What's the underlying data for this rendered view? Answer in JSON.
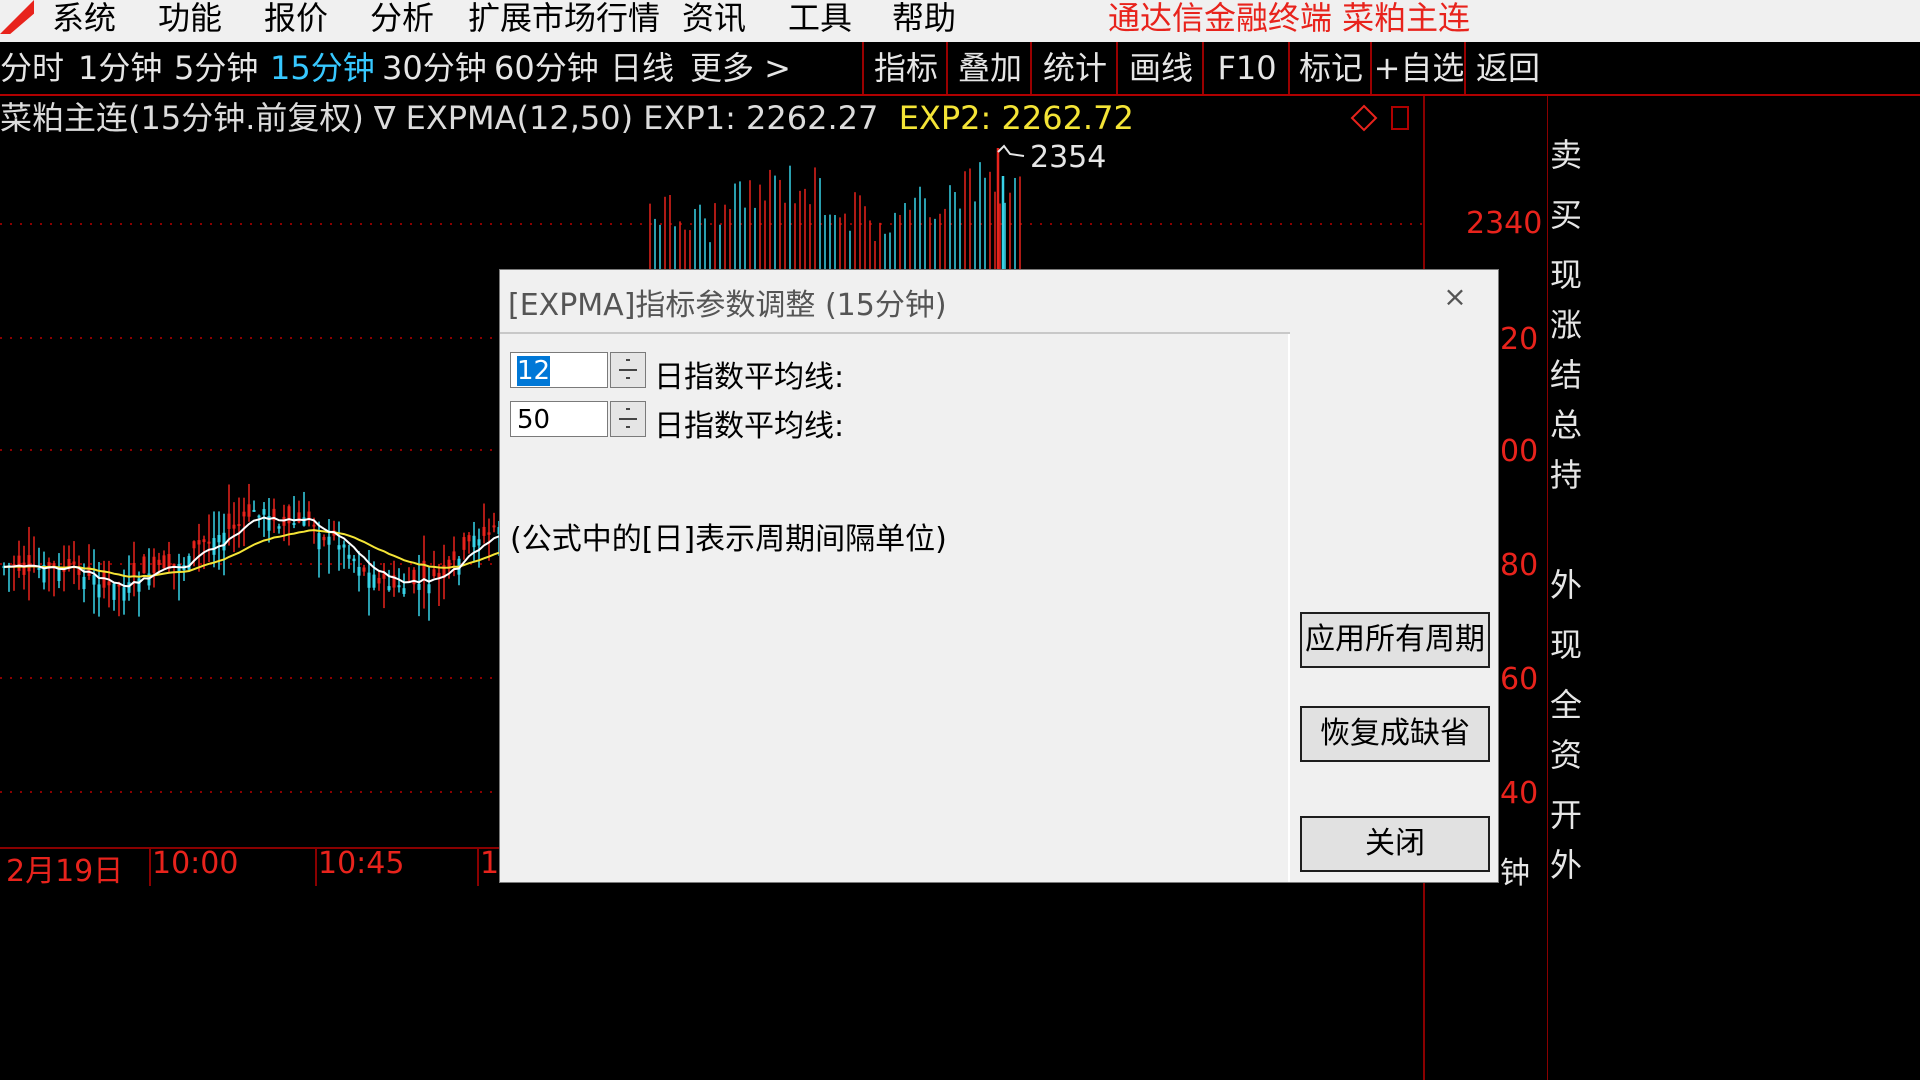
{
  "menu": {
    "items": [
      "系统",
      "功能",
      "报价",
      "分析",
      "扩展市场行情",
      "资讯",
      "工具",
      "帮助"
    ],
    "brand": "通达信金融终端  菜粕主连"
  },
  "toolbar": {
    "periods": [
      "分时",
      "1分钟",
      "5分钟",
      "15分钟",
      "30分钟",
      "60分钟",
      "日线",
      "更多 >"
    ],
    "active_period": "15分钟",
    "tools": [
      "指标",
      "叠加",
      "统计",
      "画线",
      "F10",
      "标记",
      "+自选",
      "返回"
    ]
  },
  "chart": {
    "title_prefix": "菜粕主连(15分钟.前复权)  ∇ EXPMA(12,50)  EXP1: 2262.27",
    "exp2_label": "EXP2: 2262.72",
    "peak_label": "2354",
    "y_labels": [
      "2340",
      "20",
      "00",
      "80",
      "60",
      "40"
    ],
    "x_labels": [
      "2月19日",
      "10:00",
      "10:45",
      "1"
    ],
    "right_strip_chars": [
      "卖",
      "买",
      "现",
      "涨",
      "结",
      "总",
      "持",
      "外",
      "现",
      "全",
      "资",
      "开",
      "外"
    ],
    "bottom_right": "钟"
  },
  "chart_data": {
    "type": "candlestick",
    "title": "菜粕主连(15分钟.前复权)",
    "indicator": "EXPMA(12,50)",
    "series": [
      {
        "name": "EXP1",
        "value": 2262.27
      },
      {
        "name": "EXP2",
        "value": 2262.72
      }
    ],
    "visible_y_ticks": [
      2340
    ],
    "peak_value": 2354,
    "x_ticks": [
      "2月19日",
      "10:00",
      "10:45"
    ]
  },
  "dialog": {
    "title": "[EXPMA]指标参数调整 (15分钟)",
    "close_symbol": "×",
    "params": [
      {
        "value": "12",
        "label": "日指数平均线:"
      },
      {
        "value": "50",
        "label": "日指数平均线:"
      }
    ],
    "note": "(公式中的[日]表示周期间隔单位)",
    "buttons": {
      "apply_all": "应用所有周期",
      "restore_default": "恢复成缺省",
      "close": "关闭"
    }
  },
  "colors": {
    "up": "#e8231c",
    "down": "#37d3e8",
    "exp1": "#ffffff",
    "exp2": "#f4e436",
    "grid": "#8a0000"
  }
}
